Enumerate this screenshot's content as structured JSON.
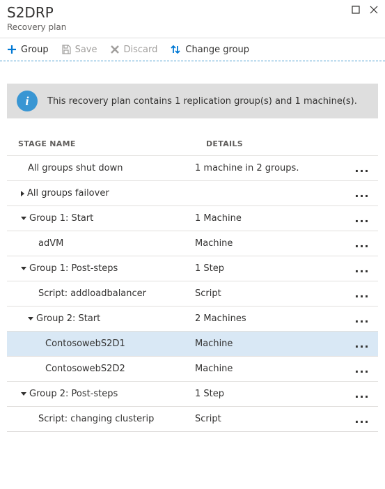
{
  "header": {
    "title": "S2DRP",
    "subtitle": "Recovery plan"
  },
  "toolbar": {
    "group_label": "Group",
    "save_label": "Save",
    "discard_label": "Discard",
    "change_group_label": "Change group"
  },
  "banner": {
    "text": "This recovery plan contains 1 replication group(s) and 1 machine(s)."
  },
  "columns": {
    "stage": "STAGE NAME",
    "details": "DETAILS"
  },
  "rows": [
    {
      "indent": 30,
      "caret": "",
      "selected": false,
      "name": "All groups shut down",
      "details": "1 machine in 2 groups."
    },
    {
      "indent": 20,
      "caret": "right",
      "selected": false,
      "name": "All groups failover",
      "details": ""
    },
    {
      "indent": 20,
      "caret": "down",
      "selected": false,
      "name": "Group 1: Start",
      "details": "1 Machine"
    },
    {
      "indent": 45,
      "caret": "",
      "selected": false,
      "name": "adVM",
      "details": "Machine"
    },
    {
      "indent": 20,
      "caret": "down",
      "selected": false,
      "name": "Group 1: Post-steps",
      "details": "1 Step"
    },
    {
      "indent": 45,
      "caret": "",
      "selected": false,
      "name": "Script: addloadbalancer",
      "details": "Script"
    },
    {
      "indent": 30,
      "caret": "down",
      "selected": false,
      "name": "Group 2: Start",
      "details": "2 Machines"
    },
    {
      "indent": 55,
      "caret": "",
      "selected": true,
      "name": "ContosowebS2D1",
      "details": "Machine"
    },
    {
      "indent": 55,
      "caret": "",
      "selected": false,
      "name": "ContosowebS2D2",
      "details": "Machine"
    },
    {
      "indent": 20,
      "caret": "down",
      "selected": false,
      "name": "Group 2: Post-steps",
      "details": "1 Step"
    },
    {
      "indent": 45,
      "caret": "",
      "selected": false,
      "name": "Script: changing clusterip",
      "details": "Script"
    }
  ]
}
